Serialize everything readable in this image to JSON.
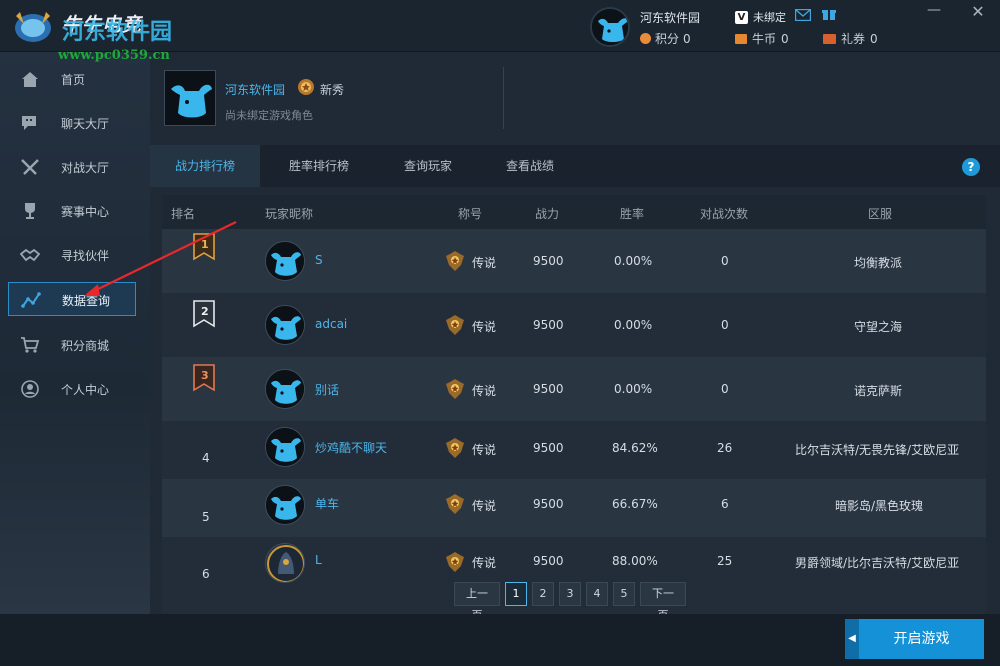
{
  "app": {
    "name": "牛牛电竞"
  },
  "watermark": {
    "title": "河东软件园",
    "url": "www.pc0359.cn"
  },
  "topbar": {
    "user_name": "河东软件园",
    "points_label": "积分",
    "points_value": "0",
    "bind_status": "未绑定",
    "coins_label": "牛币",
    "coins_value": "0",
    "tickets_label": "礼券",
    "tickets_value": "0",
    "minimize": "—",
    "close": "✕"
  },
  "sidebar": {
    "items": [
      {
        "label": "首页",
        "icon": "home-icon"
      },
      {
        "label": "聊天大厅",
        "icon": "chat-icon"
      },
      {
        "label": "对战大厅",
        "icon": "swords-icon"
      },
      {
        "label": "赛事中心",
        "icon": "trophy-icon"
      },
      {
        "label": "寻找伙伴",
        "icon": "handshake-icon"
      },
      {
        "label": "数据查询",
        "icon": "chart-icon",
        "active": true
      },
      {
        "label": "积分商城",
        "icon": "cart-icon"
      },
      {
        "label": "个人中心",
        "icon": "user-icon"
      }
    ]
  },
  "profile": {
    "name": "河东软件园",
    "rank": "新秀",
    "subtitle": "尚未绑定游戏角色"
  },
  "tabs": [
    {
      "label": "战力排行榜",
      "active": true
    },
    {
      "label": "胜率排行榜"
    },
    {
      "label": "查询玩家"
    },
    {
      "label": "查看战绩"
    }
  ],
  "help": "?",
  "table": {
    "headers": [
      "排名",
      "玩家昵称",
      "称号",
      "战力",
      "胜率",
      "对战次数",
      "区服"
    ],
    "rows": [
      {
        "rank": "1",
        "name": "S",
        "title": "传说",
        "power": "9500",
        "winrate": "0.00%",
        "battles": "0",
        "server": "均衡教派"
      },
      {
        "rank": "2",
        "name": "adcai",
        "title": "传说",
        "power": "9500",
        "winrate": "0.00%",
        "battles": "0",
        "server": "守望之海"
      },
      {
        "rank": "3",
        "name": "别话",
        "title": "传说",
        "power": "9500",
        "winrate": "0.00%",
        "battles": "0",
        "server": "诺克萨斯"
      },
      {
        "rank": "4",
        "name": "炒鸡酷不聊天",
        "title": "传说",
        "power": "9500",
        "winrate": "84.62%",
        "battles": "26",
        "server": "比尔吉沃特/无畏先锋/艾欧尼亚"
      },
      {
        "rank": "5",
        "name": "单车",
        "title": "传说",
        "power": "9500",
        "winrate": "66.67%",
        "battles": "6",
        "server": "暗影岛/黑色玫瑰"
      },
      {
        "rank": "6",
        "name": "L",
        "title": "传说",
        "power": "9500",
        "winrate": "88.00%",
        "battles": "25",
        "server": "男爵领域/比尔吉沃特/艾欧尼亚"
      }
    ]
  },
  "pager": {
    "prev": "上一页",
    "pages": [
      "1",
      "2",
      "3",
      "4",
      "5"
    ],
    "current": "1",
    "next": "下一页"
  },
  "footer": {
    "start_game": "开启游戏",
    "start_arrow": "◀"
  },
  "colors": {
    "accent": "#4db5ea",
    "start_button": "#1591d8",
    "annotation_arrow": "#e8282a"
  }
}
